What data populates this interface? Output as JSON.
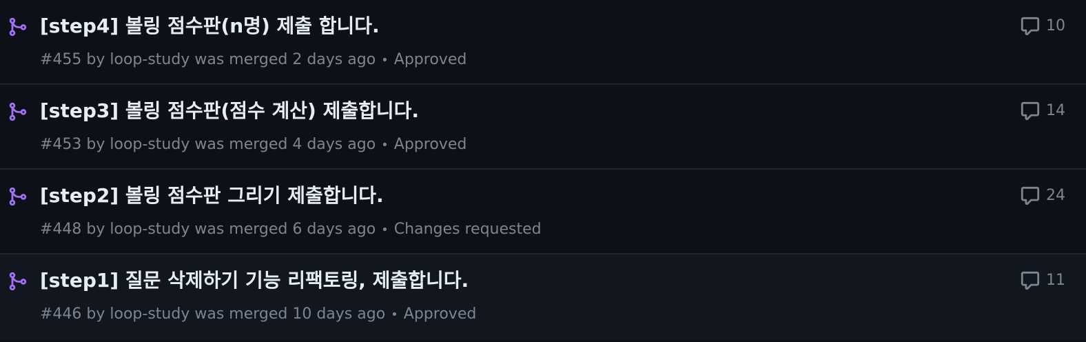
{
  "pull_requests": [
    {
      "title": "[step4] 볼링 점수판(n명) 제출 합니다.",
      "meta": "#455 by loop-study was merged 2 days ago",
      "review_status": "Approved",
      "comments": "10"
    },
    {
      "title": "[step3] 볼링 점수판(점수 계산) 제출합니다.",
      "meta": "#453 by loop-study was merged 4 days ago",
      "review_status": "Approved",
      "comments": "14"
    },
    {
      "title": "[step2] 볼링 점수판 그리기 제출합니다.",
      "meta": "#448 by loop-study was merged 6 days ago",
      "review_status": "Changes requested",
      "comments": "24"
    },
    {
      "title": "[step1] 질문 삭제하기 기능 리팩토링, 제출합니다.",
      "meta": "#446 by loop-study was merged 10 days ago",
      "review_status": "Approved",
      "comments": "11"
    }
  ],
  "separator": "•",
  "colors": {
    "background": "#0d1117",
    "merged_icon": "#a371f7",
    "title": "#e6edf3",
    "muted": "#7d8590",
    "border": "#21262d"
  },
  "icons": {
    "status": "git-merge-icon",
    "comments": "comment-icon"
  }
}
